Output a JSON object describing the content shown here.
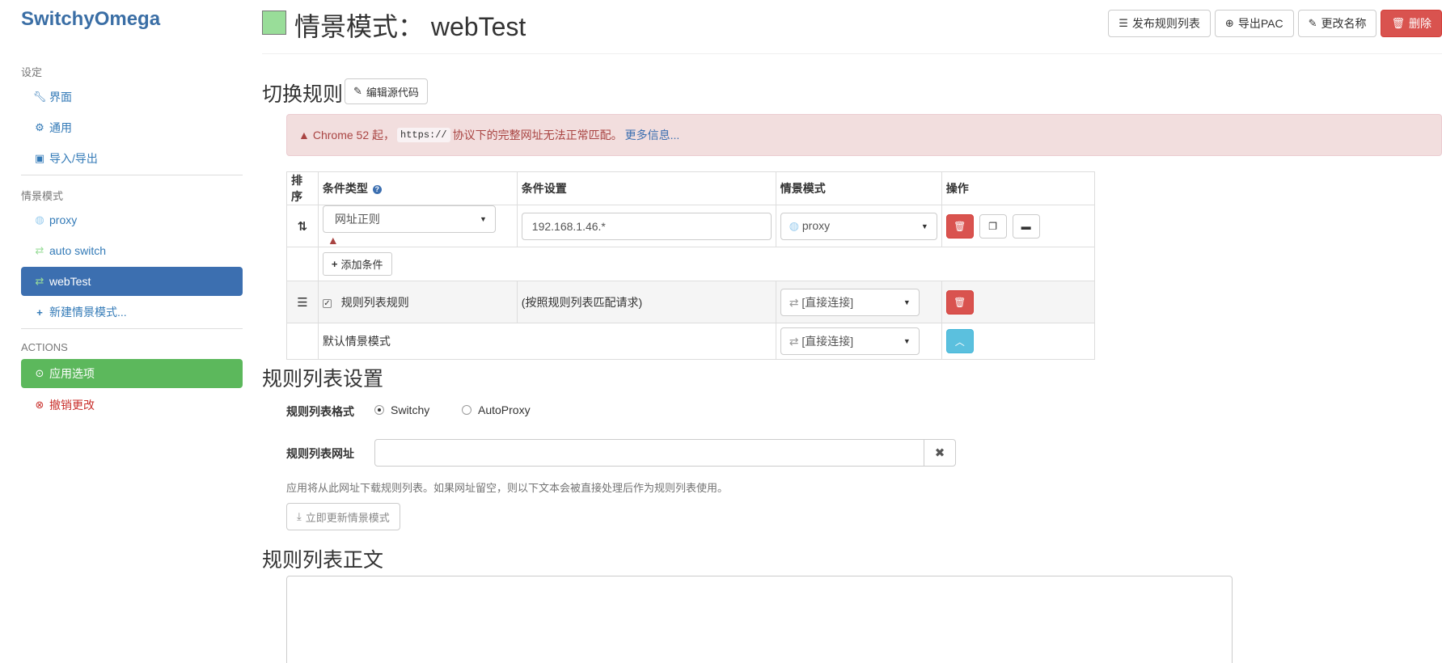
{
  "sidebar": {
    "brand": "SwitchyOmega",
    "settings_header": "设定",
    "settings_items": [
      {
        "label": "界面",
        "icon": "wrench-icon"
      },
      {
        "label": "通用",
        "icon": "gear-icon"
      },
      {
        "label": "导入/导出",
        "icon": "floppy-icon"
      }
    ],
    "profiles_header": "情景模式",
    "profiles": [
      {
        "label": "proxy",
        "icon": "globe-icon",
        "color": "#99ccee"
      },
      {
        "label": "auto switch",
        "icon": "retweet-icon",
        "color": "#99dd99"
      },
      {
        "label": "webTest",
        "icon": "retweet-icon",
        "color": "#99dd99",
        "active": true
      }
    ],
    "new_profile": "新建情景模式...",
    "actions_header": "ACTIONS",
    "apply": "应用选项",
    "discard": "撤销更改"
  },
  "header": {
    "title": "情景模式： webTest",
    "swatch_color": "#99dd99",
    "buttons": {
      "publish": "发布规则列表",
      "export_pac": "导出PAC",
      "rename": "更改名称",
      "delete": "删除"
    }
  },
  "switch_rules": {
    "heading": "切换规则",
    "edit_source": "编辑源代码",
    "alert": {
      "prefix": "Chrome 52 起，",
      "code": "https://",
      "suffix": "协议下的完整网址无法正常匹配。",
      "link": "更多信息..."
    },
    "columns": {
      "sort": "排序",
      "condition_type": "条件类型",
      "condition": "条件设置",
      "profile": "情景模式",
      "actions": "操作"
    },
    "rule": {
      "type": "网址正则",
      "value": "192.168.1.46.*",
      "profile": "proxy"
    },
    "add_condition": "添加条件",
    "rule_list_row": {
      "label": "规则列表规则",
      "desc": "(按照规则列表匹配请求)",
      "profile": "[直接连接]"
    },
    "default_row": {
      "label": "默认情景模式",
      "profile": "[直接连接]"
    }
  },
  "rule_list_settings": {
    "heading": "规则列表设置",
    "format_label": "规则列表格式",
    "format_options": [
      "Switchy",
      "AutoProxy"
    ],
    "format_selected": "Switchy",
    "url_label": "规则列表网址",
    "url_value": "",
    "help": "应用将从此网址下载规则列表。如果网址留空，则以下文本会被直接处理后作为规则列表使用。",
    "update_button": "立即更新情景模式"
  },
  "rule_list_text": {
    "heading": "规则列表正文",
    "value": ""
  }
}
